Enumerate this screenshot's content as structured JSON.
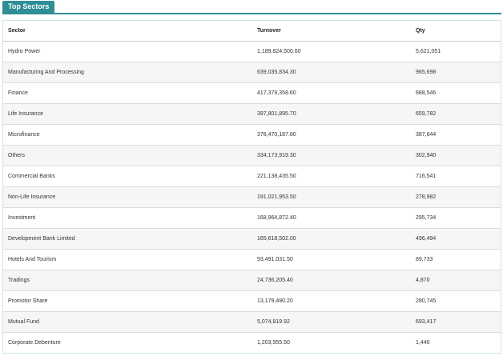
{
  "widget": {
    "tab_label": "Top Sectors"
  },
  "table": {
    "headers": [
      "Sector",
      "Turnover",
      "Qty"
    ],
    "rows": [
      [
        "Hydro Power",
        "1,189,824,500.60",
        "5,621,051"
      ],
      [
        "Manufacturing And Processing",
        "639,035,834.30",
        "965,698"
      ],
      [
        "Finance",
        "417,379,358.60",
        "688,546"
      ],
      [
        "Life Insurance",
        "397,801,895.70",
        "659,782"
      ],
      [
        "Microfinance",
        "378,470,187.80",
        "387,644"
      ],
      [
        "Others",
        "334,173,919.30",
        "302,940"
      ],
      [
        "Commercial Banks",
        "221,138,435.50",
        "716,541"
      ],
      [
        "Non-Life Insurance",
        "191,021,953.50",
        "278,982"
      ],
      [
        "Investment",
        "168,964,872.40",
        "295,734"
      ],
      [
        "Development Bank Limited",
        "165,618,502.00",
        "496,494"
      ],
      [
        "Hotels And Tourism",
        "93,491,031.50",
        "89,733"
      ],
      [
        "Tradings",
        "24,736,205.40",
        "4,870"
      ],
      [
        "Promotor Share",
        "13,179,490.20",
        "280,745"
      ],
      [
        "Mutual Fund",
        "5,074,819.92",
        "693,417"
      ],
      [
        "Corporate Debenture",
        "1,203,955.50",
        "1,440"
      ]
    ]
  }
}
